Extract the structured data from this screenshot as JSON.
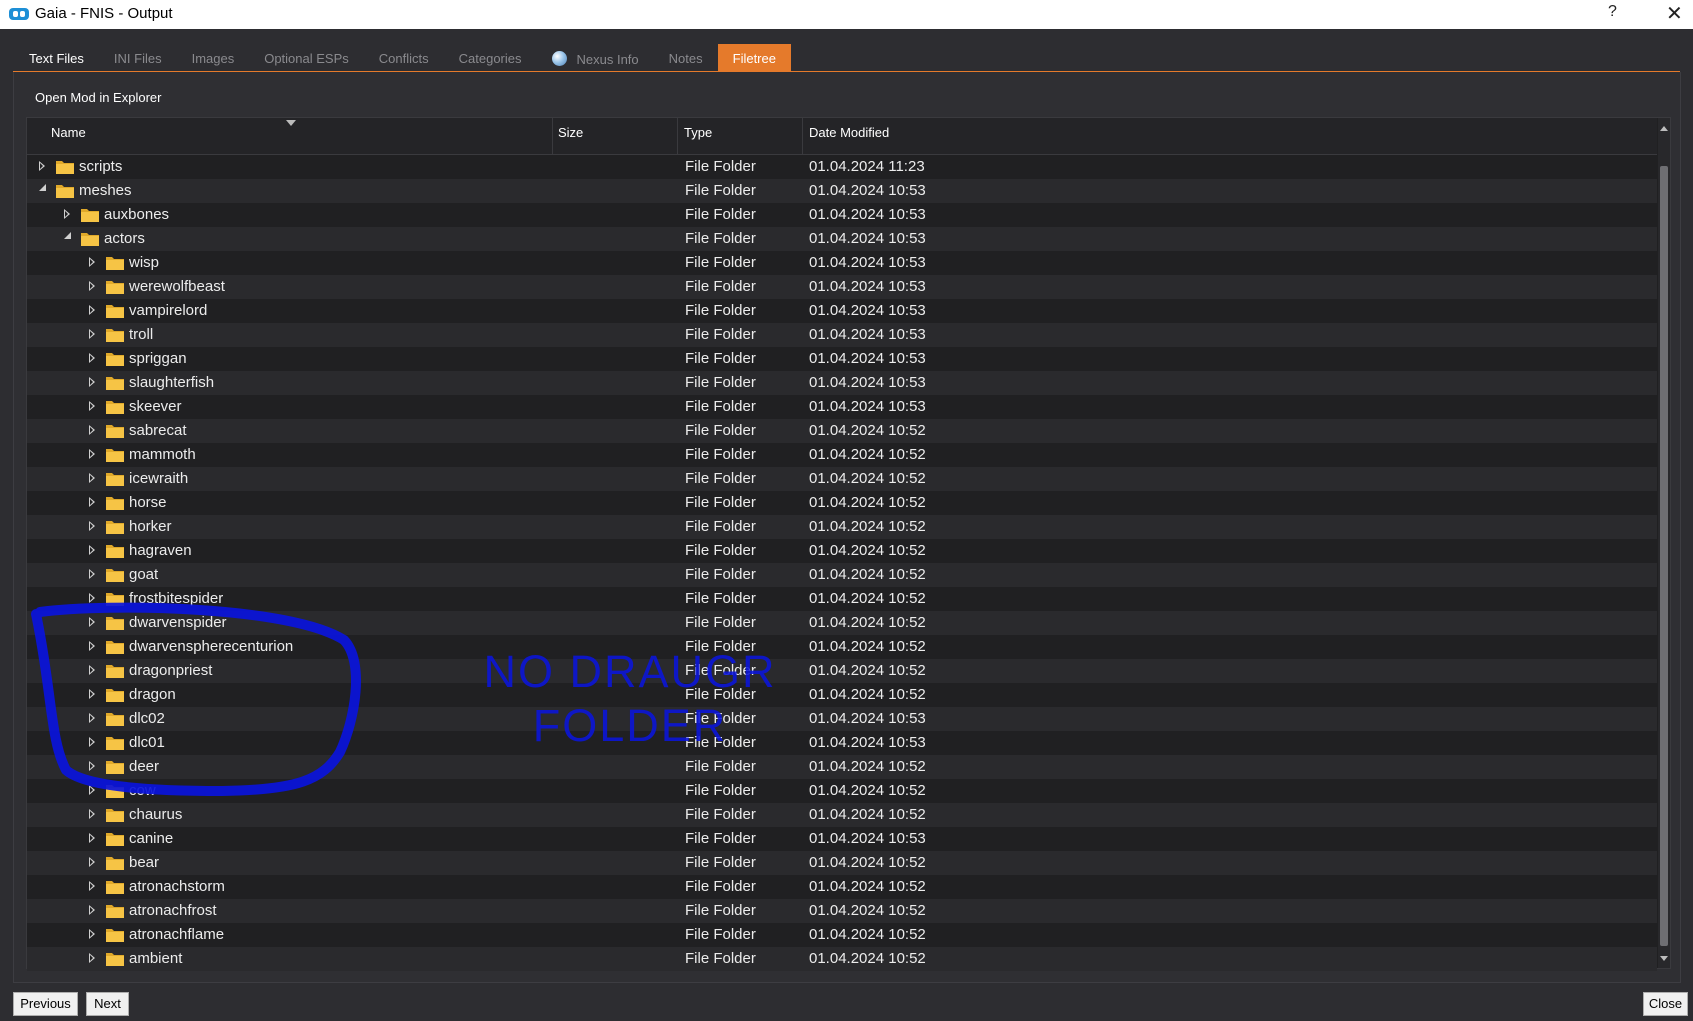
{
  "window": {
    "title": "Gaia - FNIS - Output",
    "help": "?",
    "close": "✕"
  },
  "tabs": [
    {
      "label": "Text Files"
    },
    {
      "label": "INI Files"
    },
    {
      "label": "Images"
    },
    {
      "label": "Optional ESPs"
    },
    {
      "label": "Conflicts"
    },
    {
      "label": "Categories"
    },
    {
      "label": "Nexus Info"
    },
    {
      "label": "Notes"
    },
    {
      "label": "Filetree"
    }
  ],
  "active_tab": "Filetree",
  "panel": {
    "open_mod": "Open Mod in Explorer"
  },
  "columns": {
    "name": "Name",
    "size": "Size",
    "type": "Type",
    "date": "Date Modified"
  },
  "colors": {
    "accent": "#e57a2b",
    "folder": "#f6c445",
    "annotation": "#0a14dc"
  },
  "rows": [
    {
      "name": "scripts",
      "level": 0,
      "expanded": false,
      "type": "File Folder",
      "date": "01.04.2024 11:23"
    },
    {
      "name": "meshes",
      "level": 0,
      "expanded": true,
      "type": "File Folder",
      "date": "01.04.2024 10:53"
    },
    {
      "name": "auxbones",
      "level": 1,
      "expanded": false,
      "type": "File Folder",
      "date": "01.04.2024 10:53"
    },
    {
      "name": "actors",
      "level": 1,
      "expanded": true,
      "type": "File Folder",
      "date": "01.04.2024 10:53"
    },
    {
      "name": "wisp",
      "level": 2,
      "expanded": false,
      "type": "File Folder",
      "date": "01.04.2024 10:53"
    },
    {
      "name": "werewolfbeast",
      "level": 2,
      "expanded": false,
      "type": "File Folder",
      "date": "01.04.2024 10:53"
    },
    {
      "name": "vampirelord",
      "level": 2,
      "expanded": false,
      "type": "File Folder",
      "date": "01.04.2024 10:53"
    },
    {
      "name": "troll",
      "level": 2,
      "expanded": false,
      "type": "File Folder",
      "date": "01.04.2024 10:53"
    },
    {
      "name": "spriggan",
      "level": 2,
      "expanded": false,
      "type": "File Folder",
      "date": "01.04.2024 10:53"
    },
    {
      "name": "slaughterfish",
      "level": 2,
      "expanded": false,
      "type": "File Folder",
      "date": "01.04.2024 10:53"
    },
    {
      "name": "skeever",
      "level": 2,
      "expanded": false,
      "type": "File Folder",
      "date": "01.04.2024 10:53"
    },
    {
      "name": "sabrecat",
      "level": 2,
      "expanded": false,
      "type": "File Folder",
      "date": "01.04.2024 10:52"
    },
    {
      "name": "mammoth",
      "level": 2,
      "expanded": false,
      "type": "File Folder",
      "date": "01.04.2024 10:52"
    },
    {
      "name": "icewraith",
      "level": 2,
      "expanded": false,
      "type": "File Folder",
      "date": "01.04.2024 10:52"
    },
    {
      "name": "horse",
      "level": 2,
      "expanded": false,
      "type": "File Folder",
      "date": "01.04.2024 10:52"
    },
    {
      "name": "horker",
      "level": 2,
      "expanded": false,
      "type": "File Folder",
      "date": "01.04.2024 10:52"
    },
    {
      "name": "hagraven",
      "level": 2,
      "expanded": false,
      "type": "File Folder",
      "date": "01.04.2024 10:52"
    },
    {
      "name": "goat",
      "level": 2,
      "expanded": false,
      "type": "File Folder",
      "date": "01.04.2024 10:52"
    },
    {
      "name": "frostbitespider",
      "level": 2,
      "expanded": false,
      "type": "File Folder",
      "date": "01.04.2024 10:52"
    },
    {
      "name": "dwarvenspider",
      "level": 2,
      "expanded": false,
      "type": "File Folder",
      "date": "01.04.2024 10:52"
    },
    {
      "name": "dwarvenspherecenturion",
      "level": 2,
      "expanded": false,
      "type": "File Folder",
      "date": "01.04.2024 10:52"
    },
    {
      "name": "dragonpriest",
      "level": 2,
      "expanded": false,
      "type": "File Folder",
      "date": "01.04.2024 10:52"
    },
    {
      "name": "dragon",
      "level": 2,
      "expanded": false,
      "type": "File Folder",
      "date": "01.04.2024 10:52"
    },
    {
      "name": "dlc02",
      "level": 2,
      "expanded": false,
      "type": "File Folder",
      "date": "01.04.2024 10:53"
    },
    {
      "name": "dlc01",
      "level": 2,
      "expanded": false,
      "type": "File Folder",
      "date": "01.04.2024 10:53"
    },
    {
      "name": "deer",
      "level": 2,
      "expanded": false,
      "type": "File Folder",
      "date": "01.04.2024 10:52"
    },
    {
      "name": "cow",
      "level": 2,
      "expanded": false,
      "type": "File Folder",
      "date": "01.04.2024 10:52"
    },
    {
      "name": "chaurus",
      "level": 2,
      "expanded": false,
      "type": "File Folder",
      "date": "01.04.2024 10:52"
    },
    {
      "name": "canine",
      "level": 2,
      "expanded": false,
      "type": "File Folder",
      "date": "01.04.2024 10:53"
    },
    {
      "name": "bear",
      "level": 2,
      "expanded": false,
      "type": "File Folder",
      "date": "01.04.2024 10:52"
    },
    {
      "name": "atronachstorm",
      "level": 2,
      "expanded": false,
      "type": "File Folder",
      "date": "01.04.2024 10:52"
    },
    {
      "name": "atronachfrost",
      "level": 2,
      "expanded": false,
      "type": "File Folder",
      "date": "01.04.2024 10:52"
    },
    {
      "name": "atronachflame",
      "level": 2,
      "expanded": false,
      "type": "File Folder",
      "date": "01.04.2024 10:52"
    },
    {
      "name": "ambient",
      "level": 2,
      "expanded": false,
      "type": "File Folder",
      "date": "01.04.2024 10:52"
    }
  ],
  "buttons": {
    "previous": "Previous",
    "next": "Next",
    "close": "Close"
  },
  "annotation": {
    "line1": "NO DRAUGR",
    "line2": "FOLDER"
  }
}
